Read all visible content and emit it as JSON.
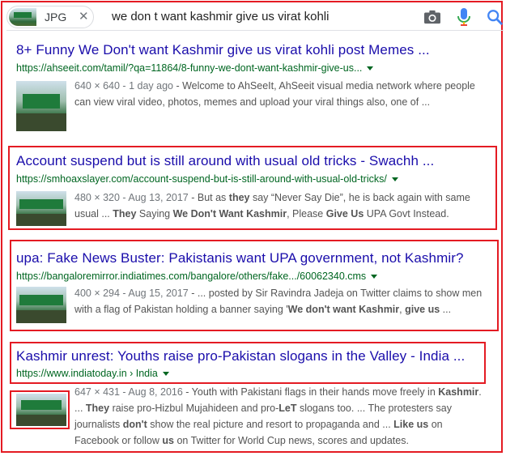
{
  "search": {
    "chip_label": "JPG",
    "chip_close": "✕",
    "query": "we don t want kashmir give us virat kohli"
  },
  "icons": {
    "camera": "camera-icon",
    "mic": "mic-icon",
    "search": "search-icon",
    "close": "close-icon",
    "dropdown": "chevron-down-icon"
  },
  "colors": {
    "title": "#1a0dab",
    "url": "#006621",
    "snippet": "#545454",
    "highlight_box": "#e41b23"
  },
  "results": [
    {
      "title": "8+ Funny We Don't want Kashmir give us virat kohli post Memes ...",
      "url": "https://ahseeit.com/tamil/?qa=11864/8-funny-we-dont-want-kashmir-give-us...",
      "meta": "640 × 640 - 1 day ago",
      "snippet_line1": " - Welcome to AhSeeIt, AhSeeit visual media network where people",
      "snippet_line2": "can view viral video, photos, memes and upload your viral things also, one of ..."
    },
    {
      "title": "Account suspend but is still around with usual old tricks - Swachh ...",
      "url": "https://smhoaxslayer.com/account-suspend-but-is-still-around-with-usual-old-tricks/",
      "meta": "480 × 320 - Aug 13, 2017",
      "snippet_line1_a": " - But as ",
      "snippet_line1_b": "they",
      "snippet_line1_c": " say “Never Say Die”, he is back again with same",
      "snippet_line2_a": "usual ... ",
      "snippet_line2_b": "They",
      "snippet_line2_c": " Saying ",
      "snippet_line2_d": "We Don't Want Kashmir",
      "snippet_line2_e": ", Please ",
      "snippet_line2_f": "Give Us",
      "snippet_line2_g": " UPA Govt Instead."
    },
    {
      "title": "upa: Fake News Buster: Pakistanis want UPA government, not Kashmir?",
      "url": "https://bangaloremirror.indiatimes.com/bangalore/others/fake.../60062340.cms",
      "meta": "400 × 294 - Aug 15, 2017",
      "snippet_line1": " - ... posted by Sir Ravindra Jadeja on Twitter claims to show men",
      "snippet_line2_a": "with a flag of Pakistan holding a banner saying '",
      "snippet_line2_b": "We don't want Kashmir",
      "snippet_line2_c": ", ",
      "snippet_line2_d": "give us",
      "snippet_line2_e": " ..."
    },
    {
      "title": "Kashmir unrest: Youths raise pro-Pakistan slogans in the Valley - India ...",
      "url": "https://www.indiatoday.in › India",
      "meta": "647 × 431 - Aug 8, 2016",
      "snippet_line1_a": " - Youth with Pakistani flags in their hands move freely in ",
      "snippet_line1_b": "Kashmir",
      "snippet_line1_c": ".",
      "snippet_line2_a": "... ",
      "snippet_line2_b": "They",
      "snippet_line2_c": " raise pro-Hizbul Mujahideen and pro-",
      "snippet_line2_d": "LeT",
      "snippet_line2_e": " slogans too. ... The protesters say",
      "snippet_line3_a": "journalists ",
      "snippet_line3_b": "don't",
      "snippet_line3_c": " show the real picture and resort to propaganda and ... ",
      "snippet_line3_d": "Like us",
      "snippet_line3_e": " on",
      "snippet_line4_a": "Facebook or follow ",
      "snippet_line4_b": "us",
      "snippet_line4_c": " on Twitter for World Cup news, scores and updates."
    }
  ]
}
